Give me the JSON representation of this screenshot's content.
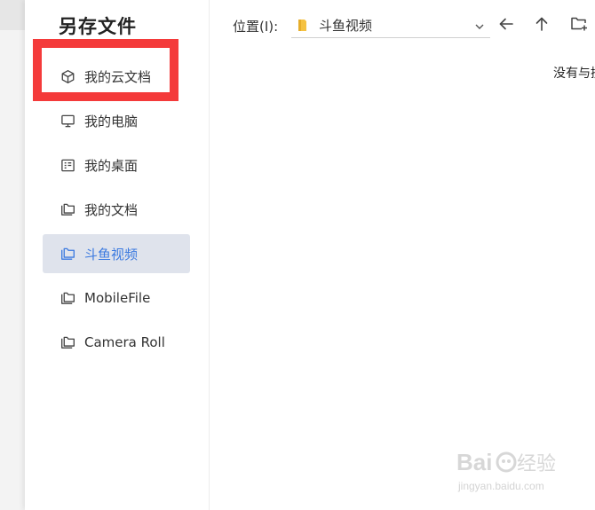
{
  "dialog": {
    "title": "另存文件"
  },
  "sidebar": {
    "items": [
      {
        "label": "我的云文档",
        "icon": "cube-icon",
        "active": false
      },
      {
        "label": "我的电脑",
        "icon": "computer-icon",
        "active": false
      },
      {
        "label": "我的桌面",
        "icon": "desktop-icon",
        "active": false
      },
      {
        "label": "我的文档",
        "icon": "folder-icon",
        "active": false
      },
      {
        "label": "斗鱼视频",
        "icon": "folder-icon",
        "active": true
      },
      {
        "label": "MobileFile",
        "icon": "folder-icon",
        "active": false
      },
      {
        "label": "Camera Roll",
        "icon": "folder-icon",
        "active": false
      }
    ]
  },
  "toolbar": {
    "location_label": "位置(I):",
    "location_value": "斗鱼视频",
    "buttons": [
      "back-arrow-icon",
      "up-arrow-icon",
      "new-folder-icon"
    ]
  },
  "main": {
    "empty_message": "没有与搜索条件匹配的项。"
  },
  "colors": {
    "accent": "#3b7ae0",
    "active_bg": "#dfe3ec",
    "highlight": "#f43a3a",
    "folder_yellow": "#f5c242"
  },
  "watermark": {
    "brand": "Baidu经验",
    "url": "jingyan.baidu.com"
  }
}
